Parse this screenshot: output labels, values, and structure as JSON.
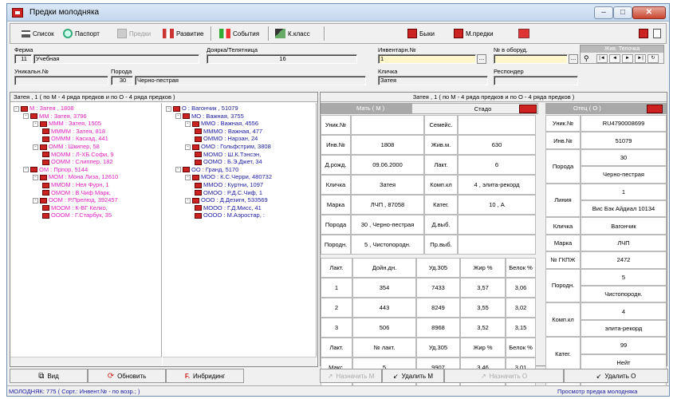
{
  "window": {
    "title": "Предки молодняка"
  },
  "toolbar": [
    {
      "label": "Список",
      "icon": "list-icon",
      "enabled": true
    },
    {
      "label": "Паспорт",
      "icon": "passport-icon",
      "enabled": true
    },
    {
      "label": "Предки",
      "icon": "ancestors-icon",
      "enabled": false
    },
    {
      "label": "Развитие",
      "icon": "development-icon",
      "enabled": true
    },
    {
      "label": "События",
      "icon": "events-icon",
      "enabled": true
    },
    {
      "label": "К.класс",
      "icon": "class-icon",
      "enabled": true
    },
    {
      "label": "Быки",
      "icon": "bull-icon",
      "enabled": true
    },
    {
      "label": "М.предки",
      "icon": "mother-ancestors-icon",
      "enabled": true
    }
  ],
  "header": {
    "farm": {
      "label": "Ферма",
      "code": "11",
      "name": "Учебная"
    },
    "milkmaid": {
      "label": "Доярка/Телятница",
      "value": "16"
    },
    "inv": {
      "label": "Инвентарн.№",
      "value": "1"
    },
    "equip": {
      "label": "№ в оборуд.",
      "value": ""
    },
    "uniq": {
      "label": "Уникальн.№",
      "value": ""
    },
    "breed": {
      "label": "Порода",
      "code": "30",
      "name": "Черно-пестрая"
    },
    "nick": {
      "label": "Кличка",
      "value": "Затея"
    },
    "responder": {
      "label": "Респондер",
      "value": ""
    },
    "nav_title": "Жив. Телочка"
  },
  "tree": {
    "header": "Затея , 1 ( по М - 4 ряда предков и по О - 4 ряда предков )",
    "left": [
      {
        "level": 0,
        "text": "М : Затея , 1808",
        "color": "m",
        "box": "-"
      },
      {
        "level": 1,
        "text": "ММ : Затея, 3796",
        "color": "m",
        "box": "-"
      },
      {
        "level": 2,
        "text": "МММ : Затея, 1505",
        "color": "m",
        "box": "-"
      },
      {
        "level": 3,
        "text": "ММММ : Затея, 818",
        "color": "m",
        "box": ""
      },
      {
        "level": 3,
        "text": "ОМММ : Каскад, 441",
        "color": "m",
        "box": ""
      },
      {
        "level": 2,
        "text": "ОММ : Шкипер, 58",
        "color": "m",
        "box": "-"
      },
      {
        "level": 3,
        "text": "МОММ : Л-ХБ Софи, 9",
        "color": "m",
        "box": ""
      },
      {
        "level": 3,
        "text": "ООММ : Слиппер, 182",
        "color": "m",
        "box": ""
      },
      {
        "level": 1,
        "text": "ОМ : Прпор, 5144",
        "color": "m",
        "box": "-"
      },
      {
        "level": 2,
        "text": "МОМ : Мона Лиза, 12610",
        "color": "m",
        "box": "-"
      },
      {
        "level": 3,
        "text": "ММОМ : Нел Фурн, 1",
        "color": "m",
        "box": ""
      },
      {
        "level": 3,
        "text": "ОМОМ : В.Чиф Марк,",
        "color": "m",
        "box": ""
      },
      {
        "level": 2,
        "text": "ООМ : Р.Прелюд, 392457",
        "color": "m",
        "box": "-"
      },
      {
        "level": 3,
        "text": "МООМ : К-ВГ Келко,",
        "color": "m",
        "box": ""
      },
      {
        "level": 3,
        "text": "ОООМ : Г.Старбук, 35",
        "color": "m",
        "box": ""
      }
    ],
    "right": [
      {
        "level": 0,
        "text": "О : Вагончик , 51079",
        "color": "b",
        "box": "-"
      },
      {
        "level": 1,
        "text": "МО : Важная, 3755",
        "color": "b",
        "box": "-"
      },
      {
        "level": 2,
        "text": "ММО : Важная, 4556",
        "color": "b",
        "box": "-"
      },
      {
        "level": 3,
        "text": "ММMО : Важная, 477",
        "color": "b",
        "box": ""
      },
      {
        "level": 3,
        "text": "ОММО : Нарзан, 24",
        "color": "b",
        "box": ""
      },
      {
        "level": 2,
        "text": "ОМО : Гольфстрим, 3808",
        "color": "b",
        "box": "-"
      },
      {
        "level": 3,
        "text": "МОМО : Ш.К.Тэнсэн,",
        "color": "b",
        "box": ""
      },
      {
        "level": 3,
        "text": "ООМО : Б.Э.Джет, 34",
        "color": "b",
        "box": ""
      },
      {
        "level": 1,
        "text": "ОО : Гранд, 5170",
        "color": "b",
        "box": "-"
      },
      {
        "level": 2,
        "text": "МОО : К.С.Черри, 480732",
        "color": "b",
        "box": "-"
      },
      {
        "level": 3,
        "text": "ММОО : Куртни, 1097",
        "color": "b",
        "box": ""
      },
      {
        "level": 3,
        "text": "ОМОО : Р.Д.С.Чиф, 1",
        "color": "b",
        "box": ""
      },
      {
        "level": 2,
        "text": "ООО : Д.Дезигн, 533569",
        "color": "b",
        "box": "-"
      },
      {
        "level": 3,
        "text": "МООО : Г.Д.Мисс, 41",
        "color": "b",
        "box": ""
      },
      {
        "level": 3,
        "text": "ОООО : М.Аэростар, :",
        "color": "b",
        "box": ""
      }
    ]
  },
  "detail": {
    "header": "Затея , 1 ( по М - 4 ряда предков и по О - 4 ряда предков )",
    "mother_title": "Мать ( М )",
    "herd_label": "Стадо",
    "father_title": "Отец ( О )",
    "mother": [
      {
        "label": "Уник.№",
        "value": "",
        "label2": "Семейс.",
        "value2": ""
      },
      {
        "label": "Инв.№",
        "value": "1808",
        "label2": "Жив.м.",
        "value2": "630"
      },
      {
        "label": "Д.рожд.",
        "value": "09.06.2000",
        "label2": "Лакт.",
        "value2": "6"
      },
      {
        "label": "Кличка",
        "value": "Затея",
        "label2": "Комп.кл",
        "value2": "4 , элита-рекорд"
      },
      {
        "label": "Марка",
        "value": "ЛЧП , 87058",
        "label2": "Катег.",
        "value2": "10 , А"
      },
      {
        "label": "Порода",
        "value": "30 , Черно-пестрая",
        "label2": "Д.выб.",
        "value2": ""
      },
      {
        "label": "Породн.",
        "value": "5 , Чистопородн.",
        "label2": "Пр.выб.",
        "value2": ""
      }
    ],
    "lact_headers": [
      "Лакт.",
      "Дойн.дн.",
      "Уд.305",
      "Жир %",
      "Белок %"
    ],
    "lact_rows": [
      [
        "1",
        "354",
        "7433",
        "3,57",
        "3,06"
      ],
      [
        "2",
        "443",
        "8249",
        "3,55",
        "3,02"
      ],
      [
        "3",
        "506",
        "8968",
        "3,52",
        "3,15"
      ]
    ],
    "lact_headers2": [
      "Лакт.",
      "№ лакт.",
      "Уд.305",
      "Жир %",
      "Белок %"
    ],
    "lact_rows2": [
      [
        "Макс.",
        "5",
        "9907",
        "3,46",
        "3,01"
      ],
      [
        "Сред.",
        "1-6",
        "8711",
        "3,52",
        "3,09"
      ]
    ],
    "father": {
      "uniq_label": "Уник.№",
      "uniq": "RU4790008699",
      "inv_label": "Инв.№",
      "inv": "51079",
      "breed_label": "Порода",
      "breed_code": "30",
      "breed_name": "Черно-пестрая",
      "line_label": "Линия",
      "line_code": "1",
      "line_name": "Вис Бэк Айдиал 10134",
      "nick_label": "Кличка",
      "nick": "Вагончик",
      "mark_label": "Марка",
      "mark": "ЛЧП",
      "gkpzh_label": "№ ГКПЖ",
      "gkpzh": "2472",
      "pur_label": "Породн.",
      "pur_code": "5",
      "pur_name": "Чистопородн.",
      "comp_label": "Комп.кл",
      "comp_code": "4",
      "comp_name": "элита-рекорд",
      "cat_label": "Катег.",
      "cat_code": "99",
      "cat_name": "Нейт",
      "birth_label": "Д.рожд.",
      "birth": "18.08.2000"
    }
  },
  "buttons": {
    "view": "Вид",
    "refresh": "Обновить",
    "inbreeding": "Инбридинг",
    "assign_m": "Назначить М",
    "delete_m": "Удалить М",
    "assign_o": "Назначить О",
    "delete_o": "Удалить О"
  },
  "status": {
    "left": "МОЛОДНЯК: 775 ( Сорт.: Инвент.№ - по возр.; )",
    "right": "Просмотр предка молодняка"
  }
}
